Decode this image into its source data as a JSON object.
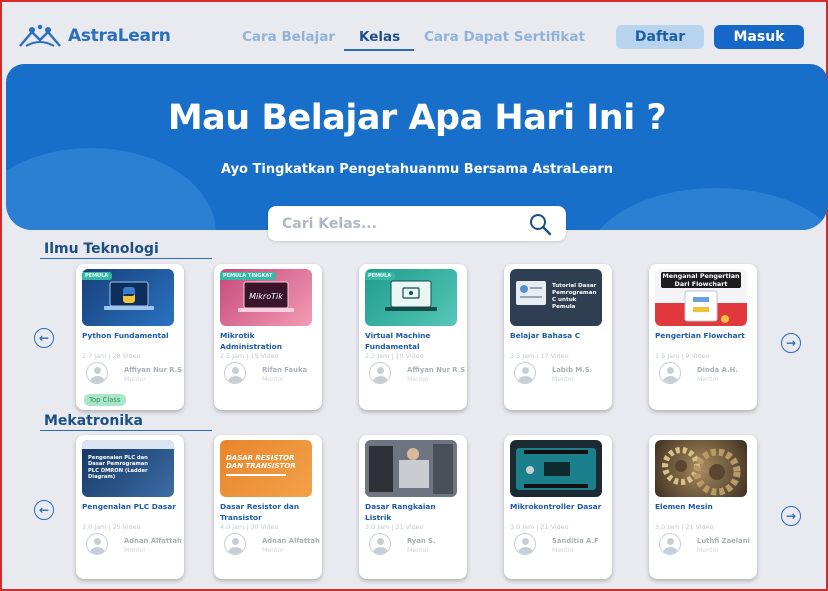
{
  "brand": {
    "name": "AstraLearn"
  },
  "nav": {
    "links": [
      "Cara Belajar",
      "Kelas",
      "Cara Dapat Sertifikat"
    ],
    "active": "Kelas",
    "daftar": "Daftar",
    "masuk": "Masuk"
  },
  "hero": {
    "title": "Mau Belajar Apa Hari Ini ?",
    "subtitle": "Ayo Tingkatkan Pengetahuanmu Bersama AstraLearn",
    "search_placeholder": "Cari Kelas..."
  },
  "sections": [
    {
      "title": "Ilmu  Teknologi",
      "courses": [
        {
          "tag": "PEMULA",
          "title": "Python Fundamental",
          "meta": "2.7 Jam  |  28 Video",
          "mentor": "Affiyan Nur R.S",
          "role": "Mentor",
          "badge": "Top Class"
        },
        {
          "tag": "PEMULA TINGKAT",
          "title": "Mikrotik Administration",
          "meta": "2.5 Jam  |  15 Video",
          "mentor": "Rifan Fauka",
          "role": "Mentor"
        },
        {
          "tag": "PEMULA",
          "title": "Virtual Machine Fundamental",
          "meta": "2.2 Jam  |  10 Video",
          "mentor": "Affiyan Nur R.S",
          "role": "Mentor"
        },
        {
          "title": "Belajar Bahasa C",
          "meta": "3.5 Jam  |  17 Video",
          "mentor": "Labib M.S.",
          "role": "Mentor",
          "thumb_text": "Tutorial Dasar Pemrograman C untuk Pemula"
        },
        {
          "title": "Pengertian Flowchart",
          "meta": "1.5 Jam  |  9 Video",
          "mentor": "Dinda A.H.",
          "role": "Mentor",
          "thumb_text": "Menganal Pengertian Dari Flowchart"
        }
      ]
    },
    {
      "title": "Mekatronika",
      "courses": [
        {
          "title": "Pengenalan PLC Dasar",
          "meta": "3.0 Jam  |  25 Video",
          "mentor": "Adnan Alfattah",
          "role": "Mentor",
          "thumb_text": "Pengenalan PLC dan Dasar Pemrograman PLC OMRON (Ladder Diagram)"
        },
        {
          "title": "Dasar Resistor dan Transistor",
          "meta": "4.0 Jam  |  30 Video",
          "mentor": "Adnan Alfattah",
          "role": "Mentor",
          "thumb_text": "DASAR RESISTOR DAN TRANSISTOR"
        },
        {
          "title": "Dasar Rangkaian Listrik",
          "meta": "3.0 Jam  |  21 Video",
          "mentor": "Ryan S.",
          "role": "Mentor"
        },
        {
          "title": "Mikrokontroller Dasar",
          "meta": "3.0 Jam  |  21 Video",
          "mentor": "Sanditia A.F",
          "role": "Mentor"
        },
        {
          "title": "Elemen Mesin",
          "meta": "3.0 Jam  |  21 Video",
          "mentor": "Luthfi Zaelani",
          "role": "Mentor"
        }
      ]
    }
  ],
  "colors": {
    "primary": "#176fca",
    "accent": "#1668c8",
    "title": "#1b4f86",
    "tag": "#34b9a5"
  },
  "icons": {
    "logo": "book-people-icon",
    "search": "search-icon",
    "prev": "arrow-left-circle-icon",
    "next": "arrow-right-circle-icon",
    "avatar": "user-icon"
  }
}
